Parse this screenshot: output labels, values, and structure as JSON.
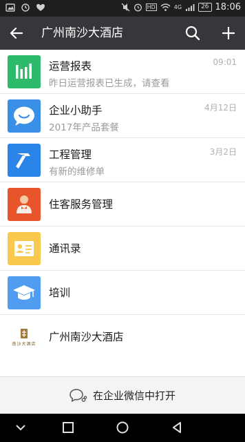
{
  "status_bar": {
    "time": "18:06",
    "battery": "26",
    "network": "4G"
  },
  "header": {
    "title": "广州南沙大酒店",
    "icons": [
      "back-arrow-icon",
      "search-icon",
      "plus-icon"
    ]
  },
  "apps": [
    {
      "name": "运营报表",
      "subtitle": "昨日运营报表已生成，请查看",
      "time": "09:01",
      "icon": "bar-chart-icon",
      "color": "#2dbb6b"
    },
    {
      "name": "企业小助手",
      "subtitle": "2017年产品套餐",
      "time": "4月12日",
      "icon": "chat-bubble-icon",
      "color": "#3a8fe6"
    },
    {
      "name": "工程管理",
      "subtitle": "有新的维修单",
      "time": "3月2日",
      "icon": "hammer-icon",
      "color": "#2b84e8"
    },
    {
      "name": "住客服务管理",
      "icon": "guest-service-icon",
      "color": "#e9552b"
    },
    {
      "name": "通讯录",
      "icon": "contact-card-icon",
      "color": "#f9c94e"
    },
    {
      "name": "培训",
      "icon": "graduation-cap-icon",
      "color": "#4f9cf0"
    },
    {
      "name": "广州南沙大酒店",
      "icon": "hotel-logo",
      "logo_text": "南沙大酒店"
    }
  ],
  "bottom_action": {
    "label": "在企业微信中打开",
    "icon": "wechat-work-icon"
  },
  "nav_icons": [
    "back-nav-icon",
    "home-nav-icon",
    "recents-nav-icon",
    "down-chevron-icon"
  ]
}
